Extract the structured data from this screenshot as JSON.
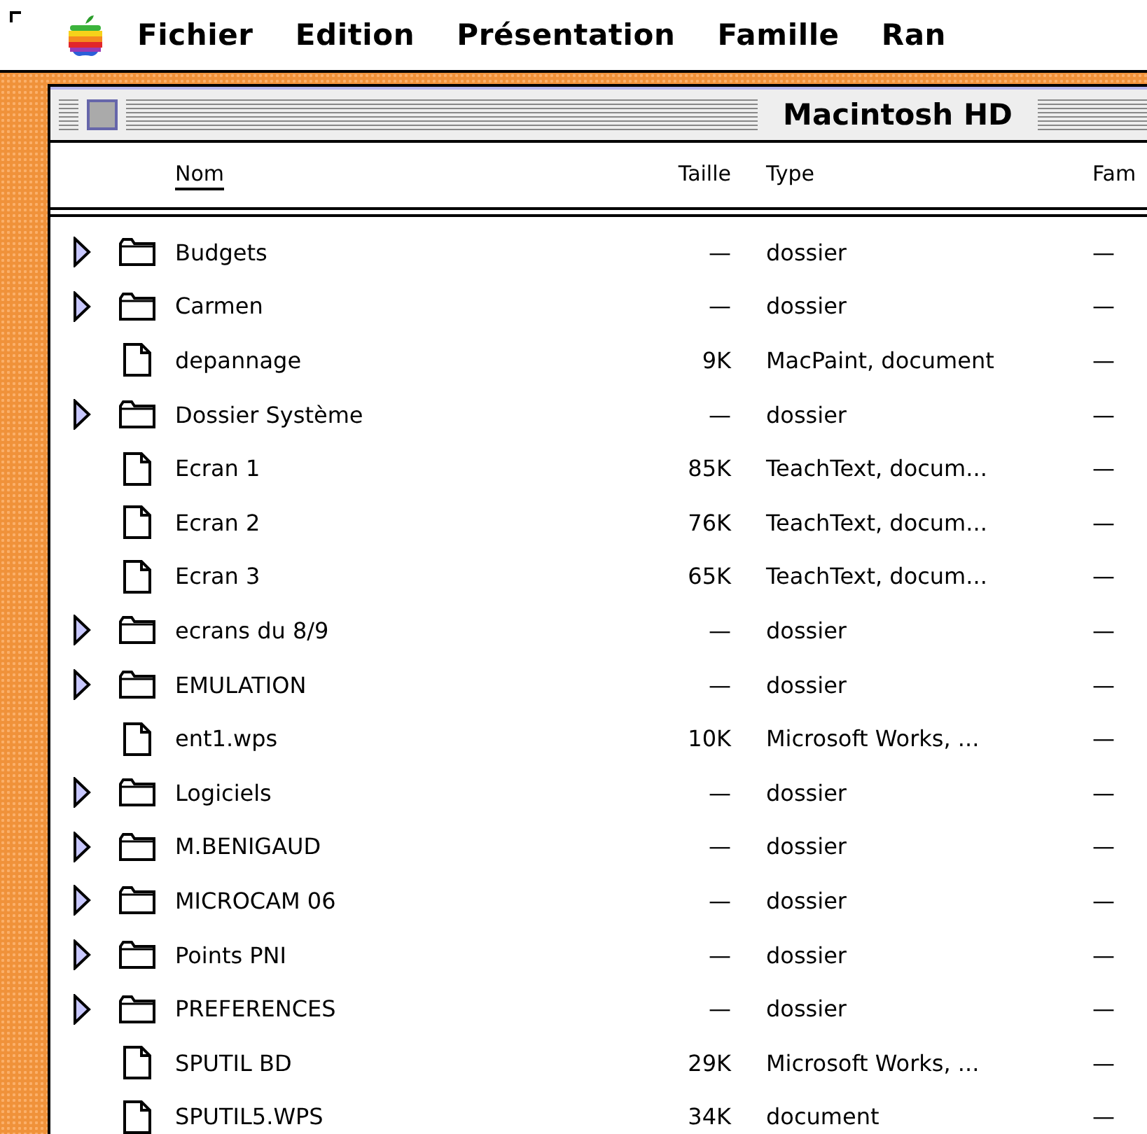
{
  "menu_bar": {
    "items": [
      "Fichier",
      "Edition",
      "Présentation",
      "Famille",
      "Ran"
    ]
  },
  "window": {
    "title": "Macintosh HD"
  },
  "table": {
    "columns": [
      {
        "label": "Nom",
        "selected": true
      },
      {
        "label": "Taille",
        "selected": false
      },
      {
        "label": "Type",
        "selected": false
      },
      {
        "label": "Fam",
        "selected": false
      }
    ],
    "rows": [
      {
        "kind": "folder",
        "name": "Budgets",
        "size": "—",
        "type": "dossier",
        "column_4": "—"
      },
      {
        "kind": "folder",
        "name": "Carmen",
        "size": "—",
        "type": "dossier",
        "column_4": "—"
      },
      {
        "kind": "file",
        "name": "depannage",
        "size": "9K",
        "type": "MacPaint, document",
        "column_4": "—"
      },
      {
        "kind": "folder",
        "name": "Dossier Système",
        "size": "—",
        "type": "dossier",
        "column_4": "—"
      },
      {
        "kind": "file",
        "name": "Ecran 1",
        "size": "85K",
        "type": "TeachText, docum...",
        "column_4": "—"
      },
      {
        "kind": "file",
        "name": "Ecran 2",
        "size": "76K",
        "type": "TeachText, docum...",
        "column_4": "—"
      },
      {
        "kind": "file",
        "name": "Ecran 3",
        "size": "65K",
        "type": "TeachText, docum...",
        "column_4": "—"
      },
      {
        "kind": "folder",
        "name": "ecrans du 8/9",
        "size": "—",
        "type": "dossier",
        "column_4": "—"
      },
      {
        "kind": "folder",
        "name": "EMULATION",
        "size": "—",
        "type": "dossier",
        "column_4": "—"
      },
      {
        "kind": "file",
        "name": "ent1.wps",
        "size": "10K",
        "type": "Microsoft Works, ...",
        "column_4": "—"
      },
      {
        "kind": "folder",
        "name": "Logiciels",
        "size": "—",
        "type": "dossier",
        "column_4": "—"
      },
      {
        "kind": "folder",
        "name": "M.BENIGAUD",
        "size": "—",
        "type": "dossier",
        "column_4": "—"
      },
      {
        "kind": "folder",
        "name": "MICROCAM 06",
        "size": "—",
        "type": "dossier",
        "column_4": "—"
      },
      {
        "kind": "folder",
        "name": "Points PNI",
        "size": "—",
        "type": "dossier",
        "column_4": "—"
      },
      {
        "kind": "folder",
        "name": "PREFERENCES",
        "size": "—",
        "type": "dossier",
        "column_4": "—"
      },
      {
        "kind": "file",
        "name": "SPUTIL BD",
        "size": "29K",
        "type": "Microsoft Works, ...",
        "column_4": "—"
      },
      {
        "kind": "file",
        "name": "SPUTIL5.WPS",
        "size": "34K",
        "type": "document",
        "column_4": "—"
      }
    ]
  }
}
